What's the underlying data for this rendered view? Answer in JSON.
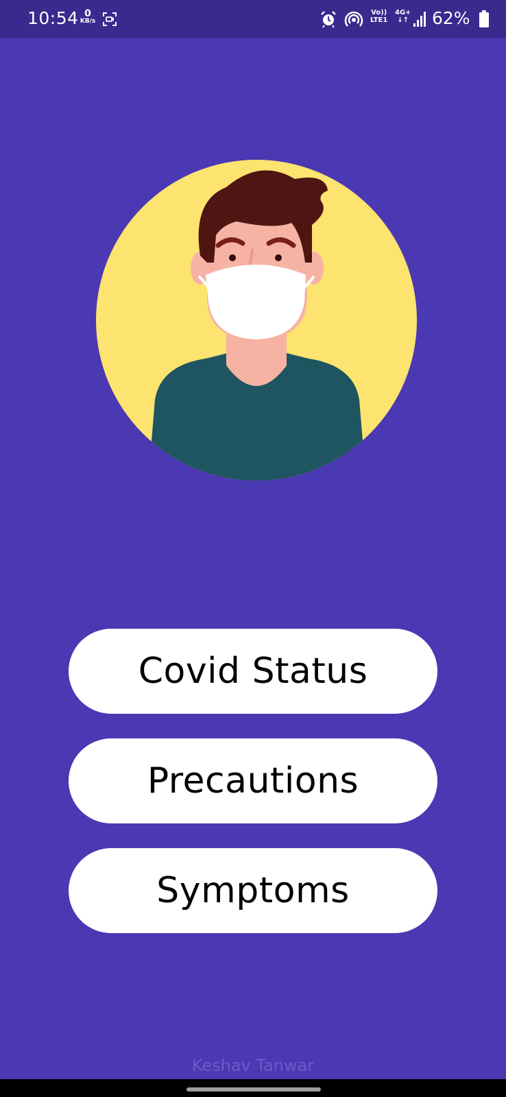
{
  "status_bar": {
    "time": "10:54",
    "data_speed_value": "0",
    "data_speed_unit": "KB/s",
    "volte_line1": "Vo))",
    "volte_line2": "LTE1",
    "network_line1": "4G+",
    "network_line2": "↓↑",
    "battery_percent": "62%",
    "icons": [
      "screen-record-icon",
      "alarm-icon",
      "hotspot-icon",
      "signal-icon",
      "battery-icon"
    ]
  },
  "illustration": {
    "subject": "person-wearing-mask-icon",
    "colors": {
      "circle": "#fde36f",
      "hair": "#4e1512",
      "skin": "#f6b3a4",
      "shirt": "#1e5560",
      "mask": "#ffffff"
    }
  },
  "buttons": {
    "covid_status": "Covid Status",
    "precautions": "Precautions",
    "symptoms": "Symptoms"
  },
  "footer": {
    "credit": "Keshav Tanwar"
  },
  "colors": {
    "background": "#4b38b3",
    "status_bar": "#3a2a8e",
    "button": "#ffffff",
    "footer_text": "#6a5cc8"
  }
}
